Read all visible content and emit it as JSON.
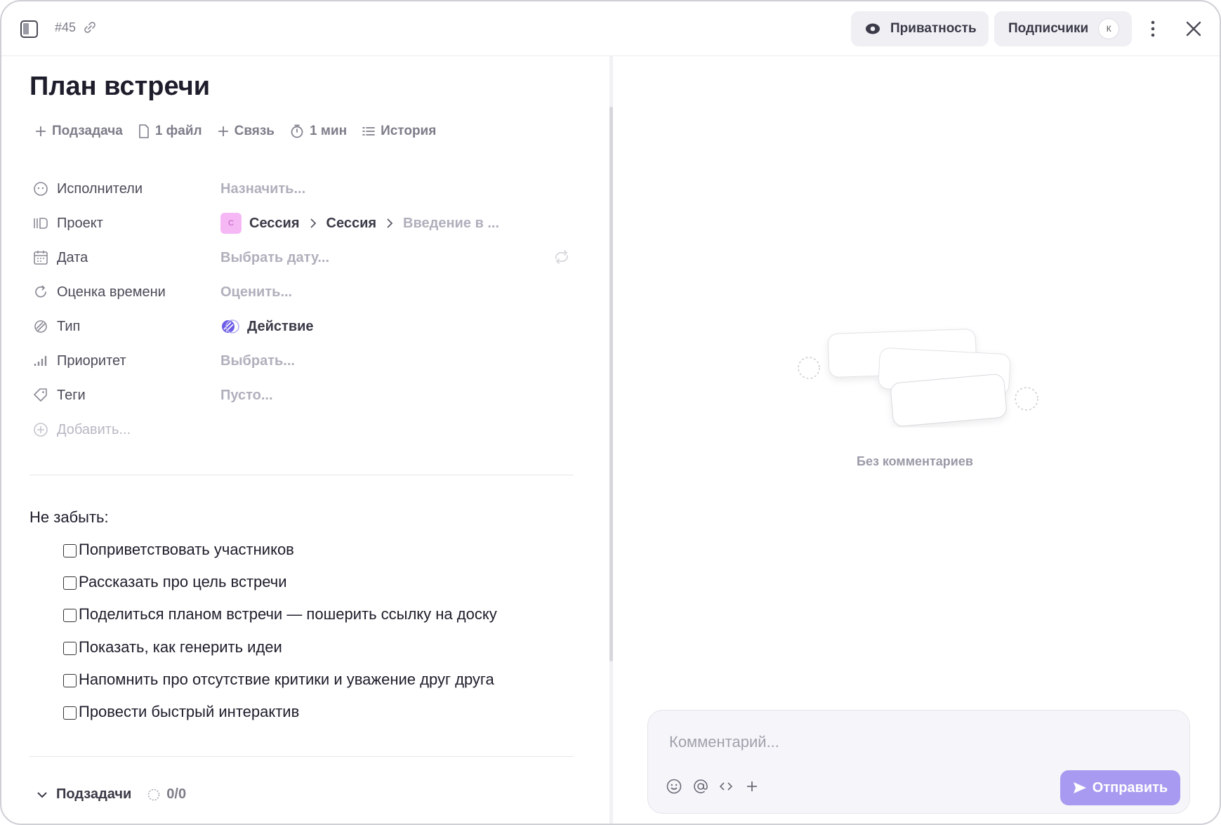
{
  "topbar": {
    "task_id": "#45",
    "privacy_label": "Приватность",
    "subscribers_label": "Подписчики",
    "subscriber_avatar": "К"
  },
  "task": {
    "title": "План встречи",
    "actions": [
      {
        "icon": "plus-icon",
        "label": "Подзадача"
      },
      {
        "icon": "file-icon",
        "label": "1 файл"
      },
      {
        "icon": "plus-icon",
        "label": "Связь"
      },
      {
        "icon": "timer-icon",
        "label": "1 мин"
      },
      {
        "icon": "list-icon",
        "label": "История"
      }
    ]
  },
  "properties": {
    "assignees": {
      "label": "Исполнители",
      "value": "Назначить..."
    },
    "project": {
      "label": "Проект",
      "badge": "С",
      "path1": "Сессия",
      "path2": "Сессия",
      "path3": "Введение в ..."
    },
    "date": {
      "label": "Дата",
      "value": "Выбрать дату..."
    },
    "estimate": {
      "label": "Оценка времени",
      "value": "Оценить..."
    },
    "type": {
      "label": "Тип",
      "value": "Действие"
    },
    "priority": {
      "label": "Приоритет",
      "value": "Выбрать..."
    },
    "tags": {
      "label": "Теги",
      "value": "Пусто..."
    },
    "add": {
      "label": "Добавить..."
    }
  },
  "notes": {
    "heading": "Не забыть:",
    "checklist": [
      "Поприветствовать участников",
      "Рассказать про цель встречи",
      "Поделиться планом встречи — пошерить ссылку на доску",
      "Показать, как генерить идеи",
      "Напомнить про отсутствие критики и уважение друг друга",
      "Провести быстрый интерактив"
    ]
  },
  "subtasks": {
    "label": "Подзадачи",
    "count": "0/0"
  },
  "comments": {
    "empty_label": "Без комментариев",
    "placeholder": "Комментарий...",
    "send_label": "Отправить"
  },
  "colors": {
    "accent": "#a89af0",
    "project_badge": "#f5b8f5",
    "type_icon": "#6c5ce7"
  }
}
